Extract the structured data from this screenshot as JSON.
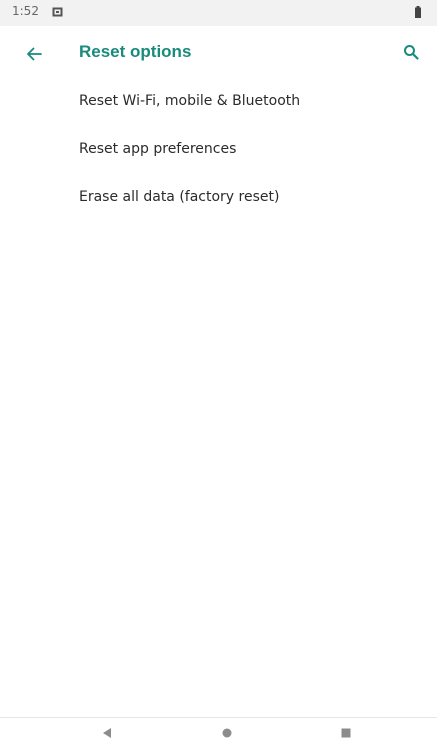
{
  "status_bar": {
    "time": "1:52",
    "notification_icon": "notification-icon",
    "battery_icon": "battery-icon"
  },
  "app_bar": {
    "title": "Reset options",
    "back_icon": "back-arrow-icon",
    "search_icon": "search-icon",
    "accent_color": "#1a8a7d"
  },
  "options": [
    {
      "label": "Reset Wi-Fi, mobile & Bluetooth"
    },
    {
      "label": "Reset app preferences"
    },
    {
      "label": "Erase all data (factory reset)"
    }
  ],
  "nav_bar": {
    "back_icon": "nav-back-triangle-icon",
    "home_icon": "nav-home-circle-icon",
    "recents_icon": "nav-recents-square-icon"
  }
}
